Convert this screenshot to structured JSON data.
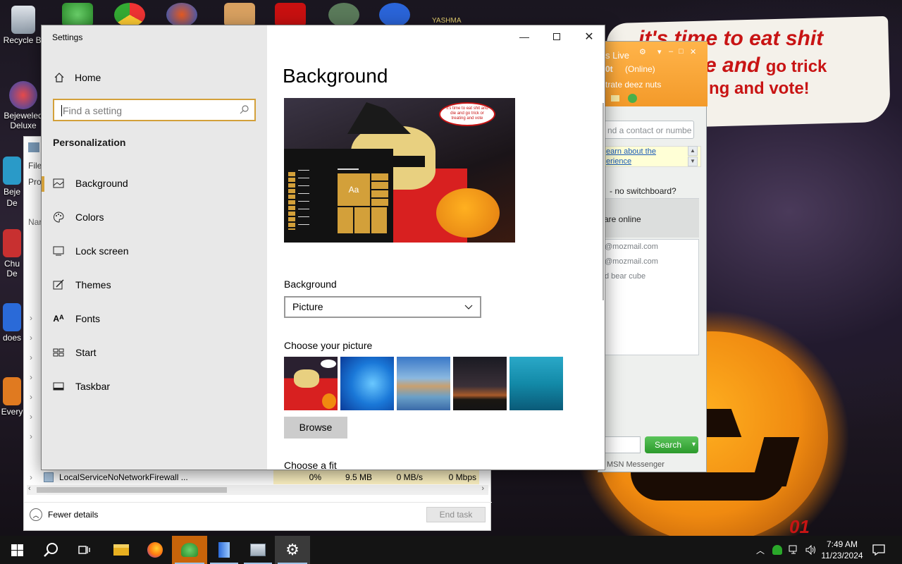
{
  "desktop": {
    "icons": [
      {
        "label": "Recycle Bi",
        "icon": "recycle-bin-icon"
      },
      {
        "label": "Bejeweled Deluxe",
        "icon": "bejeweled-icon"
      },
      {
        "label": "Beje De",
        "icon": "bejeweled-2-icon"
      },
      {
        "label": "Chu De",
        "icon": "chuzzle-icon"
      },
      {
        "label": "does",
        "icon": "game-icon"
      },
      {
        "label": "Every",
        "icon": "game-icon"
      }
    ],
    "poster": {
      "line1": "it's time to eat shit",
      "line2a": "e and",
      "line2b": "go trick",
      "line3": "ng and vote!"
    },
    "signature": "01",
    "top_label": "YASHMA"
  },
  "messenger": {
    "title": "s Live",
    "status_name": "0t",
    "status": "(Online)",
    "personal_message": "trate deez nuts",
    "search_placeholder": "nd a contact or numbe",
    "learn_link_1": "earn about the",
    "learn_link_2": "erience",
    "switchboard": "- no switchboard?",
    "online_label": "are online",
    "contacts": [
      "@mozmail.com",
      "@mozmail.com",
      "d bear cube"
    ],
    "search_button": "Search",
    "footer": "MSN Messenger"
  },
  "task_manager": {
    "left_labels": [
      "File",
      "Pro",
      "Nar"
    ],
    "process": {
      "name": "LocalServiceNoNetworkFirewall ...",
      "cpu": "0%",
      "memory": "9.5 MB",
      "disk": "0 MB/s",
      "network": "0 Mbps"
    },
    "fewer_details": "Fewer details",
    "end_task": "End task"
  },
  "settings": {
    "window_title": "Settings",
    "home_label": "Home",
    "search_placeholder": "Find a setting",
    "section_title": "Personalization",
    "nav": [
      {
        "label": "Background",
        "icon": "picture-icon",
        "active": true
      },
      {
        "label": "Colors",
        "icon": "palette-icon",
        "active": false
      },
      {
        "label": "Lock screen",
        "icon": "lock-screen-icon",
        "active": false
      },
      {
        "label": "Themes",
        "icon": "themes-icon",
        "active": false
      },
      {
        "label": "Fonts",
        "icon": "fonts-icon",
        "active": false
      },
      {
        "label": "Start",
        "icon": "start-icon",
        "active": false
      },
      {
        "label": "Taskbar",
        "icon": "taskbar-icon",
        "active": false
      }
    ],
    "page_title": "Background",
    "preview": {
      "tile_label": "Aa",
      "bubble_text": "it's time to eat shit and die and go trick or treating and vote"
    },
    "background_label": "Background",
    "background_value": "Picture",
    "choose_picture_label": "Choose your picture",
    "thumbnails": [
      "cartoon-wallpaper",
      "windows-blue",
      "beach-rocks",
      "night-sky",
      "underwater"
    ],
    "browse_label": "Browse",
    "choose_fit_label": "Choose a fit",
    "accent_color": "#d3a03a"
  },
  "taskbar": {
    "apps": [
      "start-icon",
      "search-icon",
      "task-view-icon",
      "file-explorer-icon",
      "firefox-icon",
      "msn-messenger-icon",
      "app-icon",
      "task-manager-icon",
      "settings-gear-icon"
    ],
    "time": "7:49 AM",
    "date": "11/23/2024"
  }
}
